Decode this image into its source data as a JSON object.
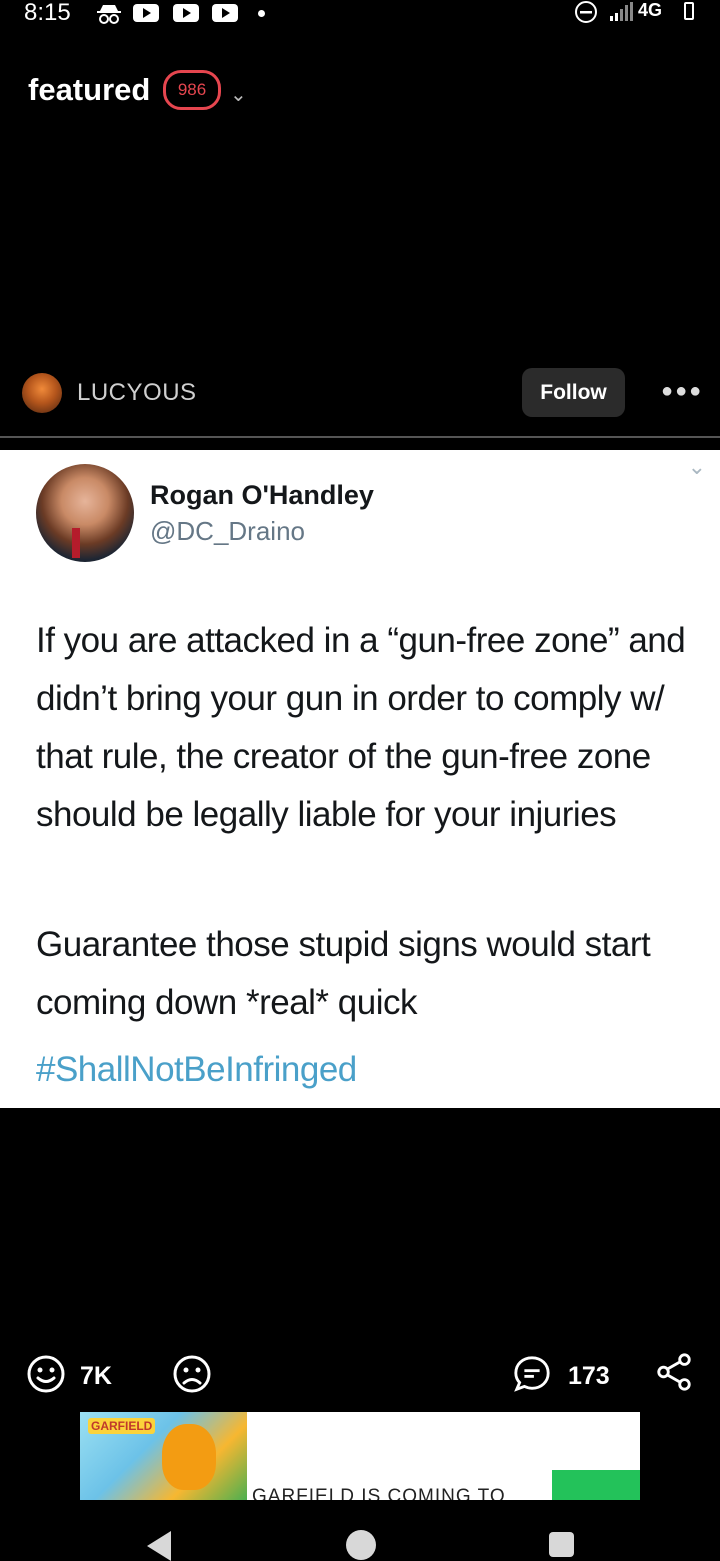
{
  "status_bar": {
    "time": "8:15",
    "network": "4G",
    "icons": [
      "incognito-icon",
      "youtube-icon",
      "youtube-icon",
      "youtube-icon",
      "notification-dot",
      "dnd-icon",
      "signal-icon",
      "battery-icon"
    ]
  },
  "header": {
    "title": "featured",
    "count": "986"
  },
  "post": {
    "author": "LUCYOUS",
    "follow_label": "Follow",
    "tweet": {
      "name": "Rogan O'Handley",
      "handle": "@DC_Draino",
      "text": "If you are attacked in a “gun-free zone” and didn’t bring your gun in order to comply w/ that rule, the creator of the gun-free zone should be legally liable for your injuries",
      "text2": "Guarantee those stupid signs would start coming down *real* quick",
      "hashtag": "#ShallNotBeInfringed"
    }
  },
  "actions": {
    "upvotes": "7K",
    "comments": "173"
  },
  "ad": {
    "brand": "GARFIELD",
    "text": "GARFIELD IS COMING TO"
  },
  "colors": {
    "background": "#000000",
    "badge": "#e6464f",
    "hashtag": "#4aa0c9",
    "follow_bg": "#2b2b2b"
  }
}
